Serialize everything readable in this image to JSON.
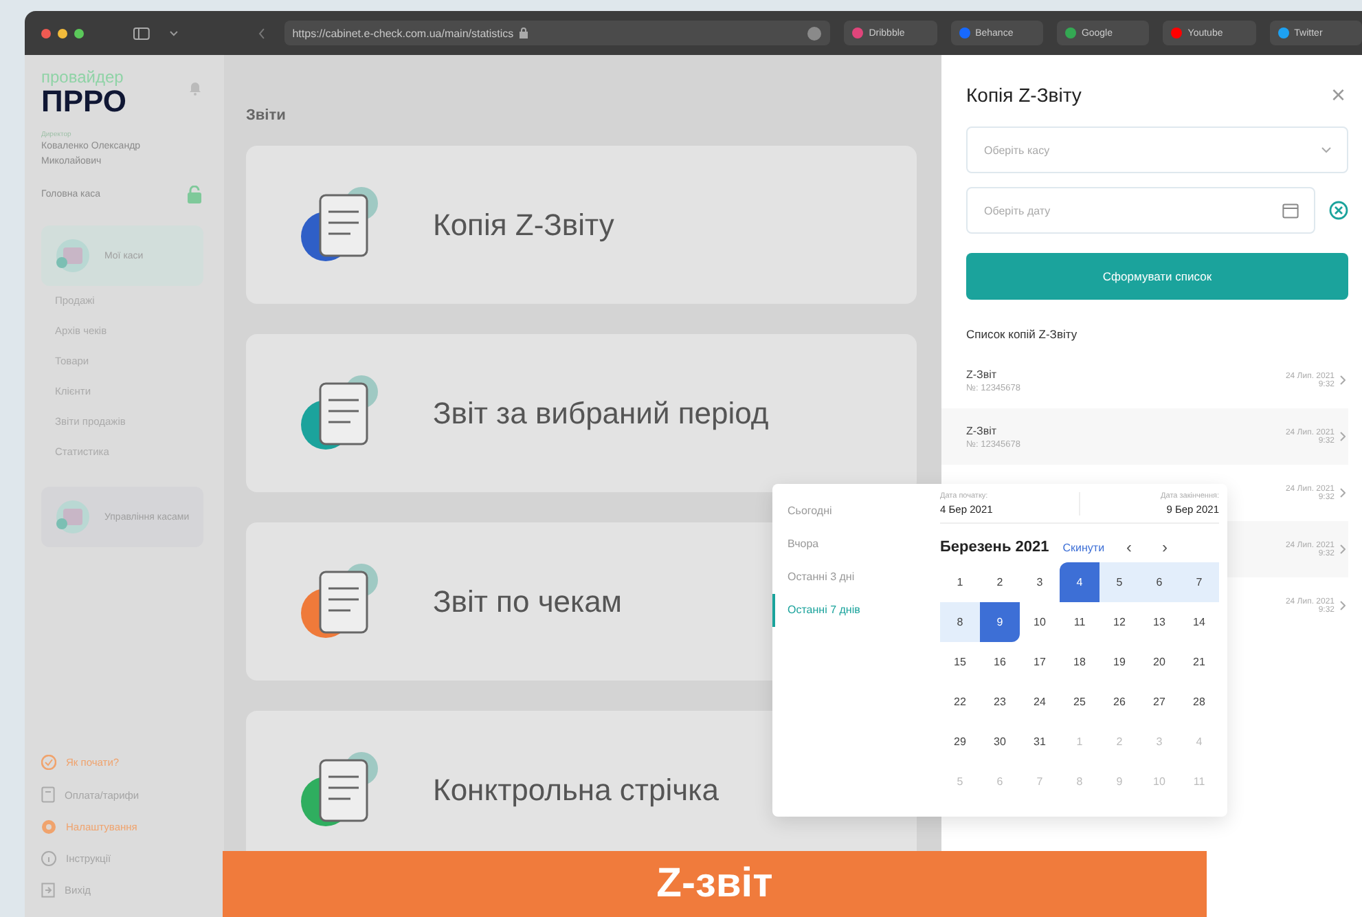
{
  "browser": {
    "url": "https://cabinet.e-check.com.ua/main/statistics",
    "bookmarks": [
      {
        "label": "Dribbble",
        "color": "#e0457b"
      },
      {
        "label": "Behance",
        "color": "#1769ff"
      },
      {
        "label": "Google",
        "color": "#34a853"
      },
      {
        "label": "Youtube",
        "color": "#ff0000"
      },
      {
        "label": "Twitter",
        "color": "#1da1f2"
      }
    ]
  },
  "sidebar": {
    "logo_top": "провайдер",
    "logo_main": "ПРРО",
    "role": "Директор",
    "user": "Коваленко Олександр Миколайович",
    "cashbox": "Головна каса",
    "sections": [
      {
        "label": "Мої каси",
        "children": [
          {
            "label": "Продажі"
          },
          {
            "label": "Архів чеків"
          },
          {
            "label": "Товари"
          },
          {
            "label": "Клієнти"
          },
          {
            "label": "Звіти продажів"
          },
          {
            "label": "Статистика"
          }
        ]
      },
      {
        "label": "Управління касами"
      }
    ],
    "bottom": [
      {
        "label": "Як почати?",
        "accent": true,
        "kind": "check"
      },
      {
        "label": "Оплата/тарифи",
        "accent": false,
        "kind": "doc"
      },
      {
        "label": "Налаштування",
        "accent": true,
        "kind": "gear"
      },
      {
        "label": "Інструкції",
        "accent": false,
        "kind": "info"
      },
      {
        "label": "Вихід",
        "accent": false,
        "kind": "exit"
      }
    ]
  },
  "main": {
    "title": "Звіти",
    "cards": [
      {
        "label": "Копія Z-Звіту",
        "color": "#2f5fc7"
      },
      {
        "label": "Звіт за вибраний період",
        "color": "#1ba39c"
      },
      {
        "label": "Звіт по чекам",
        "color": "#ef7a3a"
      },
      {
        "label": "Конктрольна стрічка",
        "color": "#2fae5f"
      }
    ]
  },
  "panel": {
    "title": "Копія Z-Звіту",
    "close": "×",
    "cashbox_placeholder": "Оберіть касу",
    "date_placeholder": "Оберіть дату",
    "button": "Сформувати список",
    "list_title": "Список копій Z-Звіту",
    "rows": [
      {
        "title": "Z-Звіт",
        "number": "№: 12345678",
        "date": "24 Лип. 2021",
        "time": "9:32",
        "highlighted": false
      },
      {
        "title": "Z-Звіт",
        "number": "№: 12345678",
        "date": "24 Лип. 2021",
        "time": "9:32",
        "highlighted": true
      },
      {
        "date": "24 Лип. 2021",
        "time": "9:32",
        "highlighted": false
      },
      {
        "date": "24 Лип. 2021",
        "time": "9:32",
        "highlighted": true
      },
      {
        "date": "24 Лип. 2021",
        "time": "9:32",
        "highlighted": false
      }
    ]
  },
  "datepicker": {
    "presets": [
      {
        "label": "Сьогодні",
        "selected": false
      },
      {
        "label": "Вчора",
        "selected": false
      },
      {
        "label": "Останні 3 дні",
        "selected": false
      },
      {
        "label": "Останні 7 днів",
        "selected": true
      }
    ],
    "start_label": "Дата початку:",
    "start": "4 Бер 2021",
    "end_label": "Дата закінчення:",
    "end": "9 Бер 2021",
    "month": "Березень 2021",
    "reset": "Скинути",
    "prev": "‹",
    "next": "›",
    "weeks": [
      [
        {
          "label": "1",
          "muted": false,
          "range_start": false,
          "range_end": false,
          "in_range": false
        },
        {
          "label": "2",
          "muted": false,
          "range_start": false,
          "range_end": false,
          "in_range": false
        },
        {
          "label": "3",
          "muted": false,
          "range_start": false,
          "range_end": false,
          "in_range": false
        },
        {
          "label": "4",
          "muted": false,
          "range_start": true,
          "range_end": false,
          "in_range": true
        },
        {
          "label": "5",
          "muted": false,
          "range_start": false,
          "range_end": false,
          "in_range": true
        },
        {
          "label": "6",
          "muted": false,
          "range_start": false,
          "range_end": false,
          "in_range": true
        },
        {
          "label": "7",
          "muted": false,
          "range_start": false,
          "range_end": false,
          "in_range": true
        }
      ],
      [
        {
          "label": "8",
          "muted": false,
          "range_start": false,
          "range_end": false,
          "in_range": true
        },
        {
          "label": "9",
          "muted": false,
          "range_start": false,
          "range_end": true,
          "in_range": true
        },
        {
          "label": "10",
          "muted": false,
          "range_start": false,
          "range_end": false,
          "in_range": false
        },
        {
          "label": "11",
          "muted": false,
          "range_start": false,
          "range_end": false,
          "in_range": false
        },
        {
          "label": "12",
          "muted": false,
          "range_start": false,
          "range_end": false,
          "in_range": false
        },
        {
          "label": "13",
          "muted": false,
          "range_start": false,
          "range_end": false,
          "in_range": false
        },
        {
          "label": "14",
          "muted": false,
          "range_start": false,
          "range_end": false,
          "in_range": false
        }
      ],
      [
        {
          "label": "15",
          "muted": false,
          "range_start": false,
          "range_end": false,
          "in_range": false
        },
        {
          "label": "16",
          "muted": false,
          "range_start": false,
          "range_end": false,
          "in_range": false
        },
        {
          "label": "17",
          "muted": false,
          "range_start": false,
          "range_end": false,
          "in_range": false
        },
        {
          "label": "18",
          "muted": false,
          "range_start": false,
          "range_end": false,
          "in_range": false
        },
        {
          "label": "19",
          "muted": false,
          "range_start": false,
          "range_end": false,
          "in_range": false
        },
        {
          "label": "20",
          "muted": false,
          "range_start": false,
          "range_end": false,
          "in_range": false
        },
        {
          "label": "21",
          "muted": false,
          "range_start": false,
          "range_end": false,
          "in_range": false
        }
      ],
      [
        {
          "label": "22",
          "muted": false,
          "range_start": false,
          "range_end": false,
          "in_range": false
        },
        {
          "label": "23",
          "muted": false,
          "range_start": false,
          "range_end": false,
          "in_range": false
        },
        {
          "label": "24",
          "muted": false,
          "range_start": false,
          "range_end": false,
          "in_range": false
        },
        {
          "label": "25",
          "muted": false,
          "range_start": false,
          "range_end": false,
          "in_range": false
        },
        {
          "label": "26",
          "muted": false,
          "range_start": false,
          "range_end": false,
          "in_range": false
        },
        {
          "label": "27",
          "muted": false,
          "range_start": false,
          "range_end": false,
          "in_range": false
        },
        {
          "label": "28",
          "muted": false,
          "range_start": false,
          "range_end": false,
          "in_range": false
        }
      ],
      [
        {
          "label": "29",
          "muted": false,
          "range_start": false,
          "range_end": false,
          "in_range": false
        },
        {
          "label": "30",
          "muted": false,
          "range_start": false,
          "range_end": false,
          "in_range": false
        },
        {
          "label": "31",
          "muted": false,
          "range_start": false,
          "range_end": false,
          "in_range": false
        },
        {
          "label": "1",
          "muted": true,
          "range_start": false,
          "range_end": false,
          "in_range": false
        },
        {
          "label": "2",
          "muted": true,
          "range_start": false,
          "range_end": false,
          "in_range": false
        },
        {
          "label": "3",
          "muted": true,
          "range_start": false,
          "range_end": false,
          "in_range": false
        },
        {
          "label": "4",
          "muted": true,
          "range_start": false,
          "range_end": false,
          "in_range": false
        }
      ],
      [
        {
          "label": "5",
          "muted": true,
          "range_start": false,
          "range_end": false,
          "in_range": false
        },
        {
          "label": "6",
          "muted": true,
          "range_start": false,
          "range_end": false,
          "in_range": false
        },
        {
          "label": "7",
          "muted": true,
          "range_start": false,
          "range_end": false,
          "in_range": false
        },
        {
          "label": "8",
          "muted": true,
          "range_start": false,
          "range_end": false,
          "in_range": false
        },
        {
          "label": "9",
          "muted": true,
          "range_start": false,
          "range_end": false,
          "in_range": false
        },
        {
          "label": "10",
          "muted": true,
          "range_start": false,
          "range_end": false,
          "in_range": false
        },
        {
          "label": "11",
          "muted": true,
          "range_start": false,
          "range_end": false,
          "in_range": false
        }
      ]
    ]
  },
  "banner": {
    "text": "Z-звіт"
  }
}
